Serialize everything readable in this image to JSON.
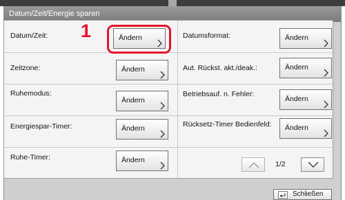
{
  "window": {
    "title": "Datum/Zeit/Energie sparen"
  },
  "step_marker": "1",
  "settings": [
    {
      "label": "Datum/Zeit:",
      "button": "Ändern"
    },
    {
      "label": "Zeitzone:",
      "button": "Ändern"
    },
    {
      "label": "Ruhemodus:",
      "button": "Ändern"
    },
    {
      "label": "Energiespar-Timer:",
      "button": "Ändern"
    },
    {
      "label": "Ruhe-Timer:",
      "button": "Ändern"
    },
    {
      "label": "Datumsformat:",
      "button": "Ändern"
    },
    {
      "label": "Aut. Rückst. akt./deak.:",
      "button": "Ändern"
    },
    {
      "label": "Betriebsauf. n. Fehler:",
      "button": "Ändern"
    },
    {
      "label": "Rücksetz-Timer Bedienfeld:",
      "button": "Ändern"
    }
  ],
  "pagination": {
    "indicator": "1/2"
  },
  "footer": {
    "close_label": "Schließen"
  },
  "colors": {
    "highlight": "#e4122b",
    "titlebar": "#8a8a8a"
  },
  "icons": {
    "button_arrow": "chevron-right-icon",
    "prev": "chevron-up-icon",
    "next": "chevron-down-icon",
    "close": "return-icon"
  }
}
